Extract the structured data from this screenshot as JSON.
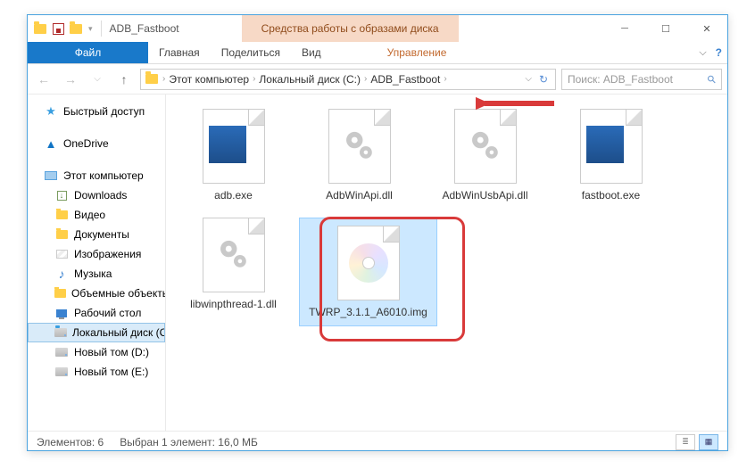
{
  "title": "ADB_Fastboot",
  "context_tab": "Средства работы с образами диска",
  "ribbon": {
    "file": "Файл",
    "home": "Главная",
    "share": "Поделиться",
    "view": "Вид",
    "manage": "Управление"
  },
  "breadcrumb": [
    "Этот компьютер",
    "Локальный диск (C:)",
    "ADB_Fastboot"
  ],
  "search_placeholder": "Поиск: ADB_Fastboot",
  "sidebar": {
    "quick": "Быстрый доступ",
    "onedrive": "OneDrive",
    "thispc": "Этот компьютер",
    "downloads": "Downloads",
    "videos": "Видео",
    "documents": "Документы",
    "pictures": "Изображения",
    "music": "Музыка",
    "volumes": "Объемные объекты",
    "desktop": "Рабочий стол",
    "localdisk": "Локальный диск (C:)",
    "newvol_d": "Новый том (D:)",
    "newvol_e": "Новый том (E:)"
  },
  "files": [
    {
      "name": "adb.exe",
      "type": "exe"
    },
    {
      "name": "AdbWinApi.dll",
      "type": "dll"
    },
    {
      "name": "AdbWinUsbApi.dll",
      "type": "dll"
    },
    {
      "name": "fastboot.exe",
      "type": "exe"
    },
    {
      "name": "libwinpthread-1.dll",
      "type": "dll"
    },
    {
      "name": "TWRP_3.1.1_A6010.img",
      "type": "img",
      "selected": true
    }
  ],
  "status": {
    "count": "Элементов: 6",
    "selection": "Выбран 1 элемент: 16,0 МБ"
  }
}
